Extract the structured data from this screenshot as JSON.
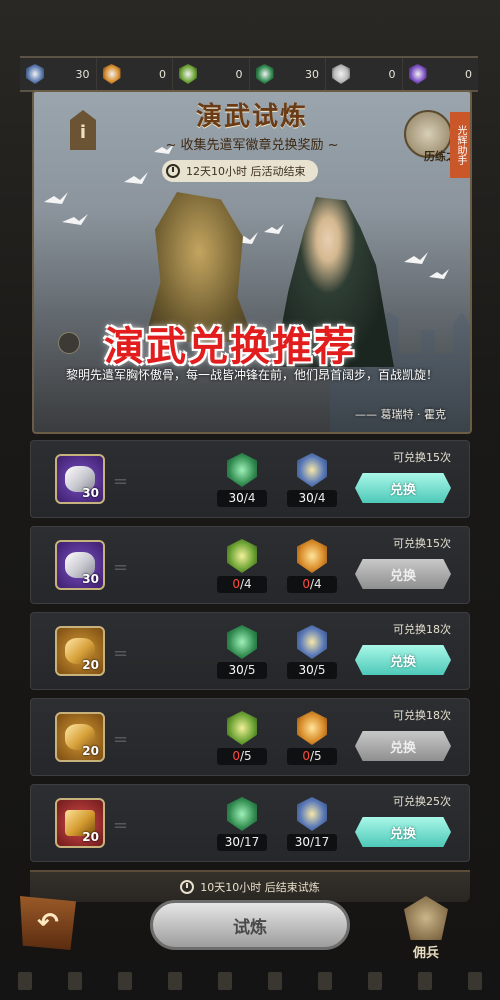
{
  "currencies": [
    {
      "icon": "blue-medal-icon",
      "color": "#5a7ab0",
      "value": "30"
    },
    {
      "icon": "orange-medal-icon",
      "color": "#d98c2a",
      "value": "0"
    },
    {
      "icon": "lime-medal-icon",
      "color": "#6ea535",
      "value": "0"
    },
    {
      "icon": "green-medal-icon",
      "color": "#2f8a4e",
      "value": "30"
    },
    {
      "icon": "silver-medal-icon",
      "color": "#b8b8b8",
      "value": "0"
    },
    {
      "icon": "purple-medal-icon",
      "color": "#7b4fc4",
      "value": "0"
    }
  ],
  "banner": {
    "info_icon": "i",
    "title": "演武试炼",
    "subtitle": "~ 收集先遣军徽章兑换奖励 ~",
    "timer": "12天10小时 后活动结束",
    "training_label": "历练之道",
    "side_tab": "光辉助手",
    "promo_text": "演武兑换推荐",
    "quote": "黎明先遣军胸怀傲骨，每一战皆冲锋在前，他们昂首阔步，百战凯旋！",
    "quote_author": "—— 葛瑞特 · 霍克"
  },
  "rows": [
    {
      "item_style": "purple",
      "item_count": "30",
      "cost_a": {
        "color": "green",
        "have": "30",
        "need": "/4",
        "ok": true
      },
      "cost_b": {
        "color": "blue",
        "have": "30",
        "need": "/4",
        "ok": true
      },
      "remaining": "可兑换15次",
      "button": "兑换",
      "enabled": true
    },
    {
      "item_style": "purple",
      "item_count": "30",
      "cost_a": {
        "color": "lime",
        "have": "0",
        "need": "/4",
        "ok": false
      },
      "cost_b": {
        "color": "orange",
        "have": "0",
        "need": "/4",
        "ok": false
      },
      "remaining": "可兑换15次",
      "button": "兑换",
      "enabled": false
    },
    {
      "item_style": "gold",
      "item_count": "20",
      "cost_a": {
        "color": "green",
        "have": "30",
        "need": "/5",
        "ok": true
      },
      "cost_b": {
        "color": "blue",
        "have": "30",
        "need": "/5",
        "ok": true
      },
      "remaining": "可兑换18次",
      "button": "兑换",
      "enabled": true
    },
    {
      "item_style": "gold",
      "item_count": "20",
      "cost_a": {
        "color": "lime",
        "have": "0",
        "need": "/5",
        "ok": false
      },
      "cost_b": {
        "color": "orange",
        "have": "0",
        "need": "/5",
        "ok": false
      },
      "remaining": "可兑换18次",
      "button": "兑换",
      "enabled": false
    },
    {
      "item_style": "red",
      "item_count": "20",
      "cost_a": {
        "color": "green",
        "have": "30",
        "need": "/17",
        "ok": true
      },
      "cost_b": {
        "color": "blue",
        "have": "30",
        "need": "/17",
        "ok": true
      },
      "remaining": "可兑换25次",
      "button": "兑换",
      "enabled": true
    }
  ],
  "footer": {
    "end_timer": "10天10小时 后结束试炼",
    "back_icon": "↶",
    "trial_button": "试炼",
    "mercenary_label": "佣兵"
  }
}
